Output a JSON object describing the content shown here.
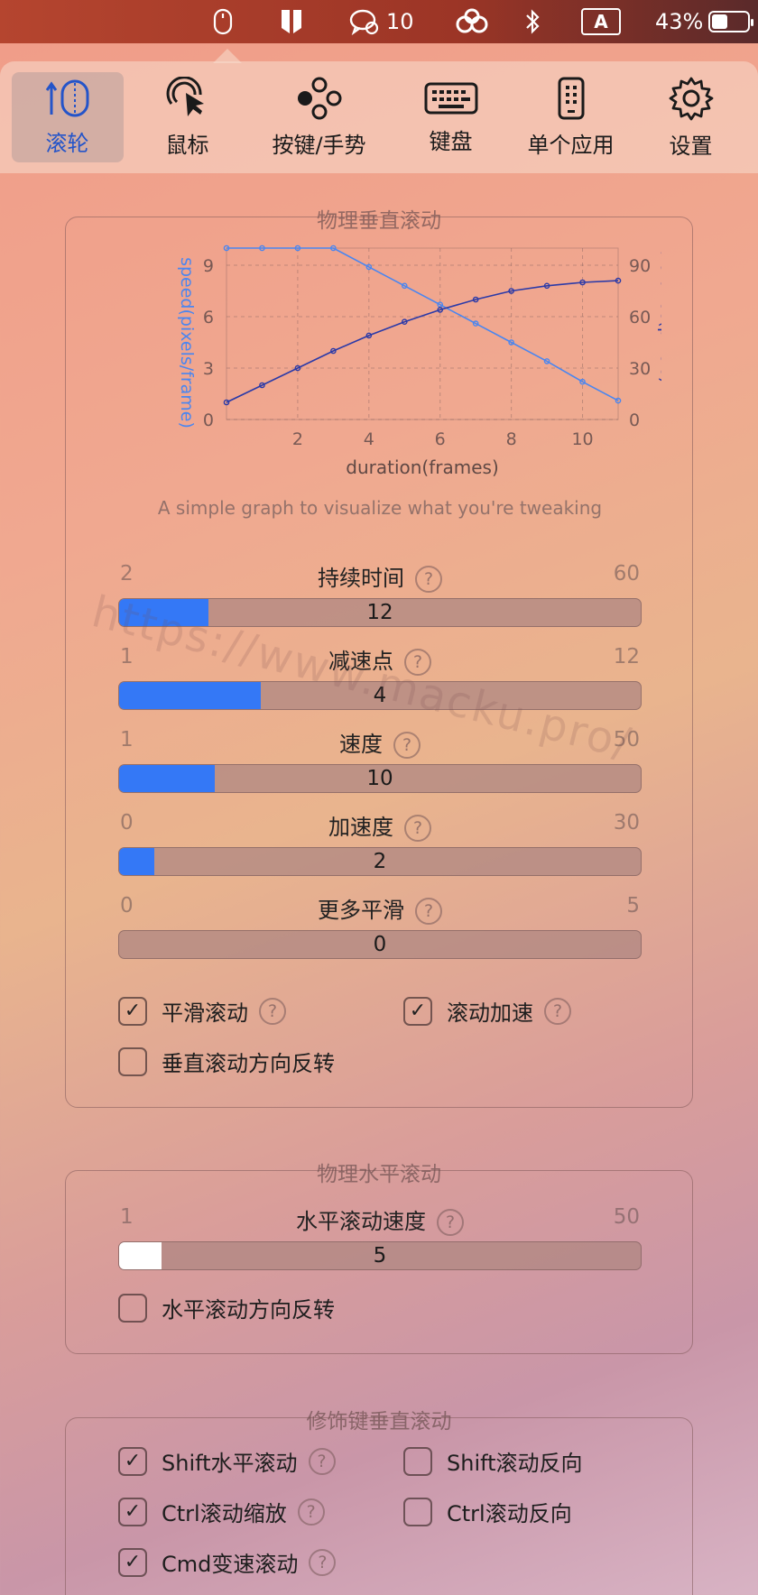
{
  "menubar": {
    "wechat_count": "10",
    "input_method": "A",
    "battery": "43%",
    "battery_level": 0.43
  },
  "toolbar": {
    "items": [
      {
        "label": "滚轮",
        "icon": "scroll-wheel-icon",
        "active": true
      },
      {
        "label": "鼠标",
        "icon": "mouse-pointer-icon",
        "active": false
      },
      {
        "label": "按键/手势",
        "icon": "gesture-buttons-icon",
        "active": false
      },
      {
        "label": "键盘",
        "icon": "keyboard-icon",
        "active": false
      },
      {
        "label": "单个应用",
        "icon": "app-device-icon",
        "active": false
      },
      {
        "label": "设置",
        "icon": "gear-icon",
        "active": false
      }
    ]
  },
  "vertical": {
    "title": "物理垂直滚动",
    "chart_caption": "A simple graph to visualize what you're tweaking",
    "sliders": [
      {
        "label": "持续时间",
        "min": "2",
        "max": "60",
        "value": "12",
        "fill": 0.172
      },
      {
        "label": "减速点",
        "min": "1",
        "max": "12",
        "value": "4",
        "fill": 0.272
      },
      {
        "label": "速度",
        "min": "1",
        "max": "50",
        "value": "10",
        "fill": 0.184
      },
      {
        "label": "加速度",
        "min": "0",
        "max": "30",
        "value": "2",
        "fill": 0.067
      },
      {
        "label": "更多平滑",
        "min": "0",
        "max": "5",
        "value": "0",
        "fill": 0
      }
    ],
    "checks": [
      {
        "label": "平滑滚动",
        "checked": true,
        "help": true
      },
      {
        "label": "滚动加速",
        "checked": true,
        "help": true
      },
      {
        "label": "垂直滚动方向反转",
        "checked": false,
        "help": false
      }
    ]
  },
  "horizontal": {
    "title": "物理水平滚动",
    "slider": {
      "label": "水平滚动速度",
      "min": "1",
      "max": "50",
      "value": "5",
      "fill": 0.082
    },
    "check": {
      "label": "水平滚动方向反转",
      "checked": false
    }
  },
  "modifier": {
    "title": "修饰键垂直滚动",
    "checks": [
      {
        "label": "Shift水平滚动",
        "checked": true,
        "help": true
      },
      {
        "label": "Shift滚动反向",
        "checked": false,
        "help": false
      },
      {
        "label": "Ctrl滚动缩放",
        "checked": true,
        "help": true
      },
      {
        "label": "Ctrl滚动反向",
        "checked": false,
        "help": false
      },
      {
        "label": "Cmd变速滚动",
        "checked": true,
        "help": true
      }
    ]
  },
  "watermark": "https://www.macku.pro/",
  "chart_data": {
    "type": "line",
    "xlabel": "duration(frames)",
    "ylabel": "speed(pixels/frame)",
    "ylabel_right": "distance(pixels)",
    "x": [
      0,
      1,
      2,
      3,
      4,
      5,
      6,
      7,
      8,
      9,
      10,
      11
    ],
    "xlim": [
      0,
      11
    ],
    "ylim": [
      0,
      10
    ],
    "ylim_right": [
      0,
      100
    ],
    "x_ticks": [
      2,
      4,
      6,
      8,
      10
    ],
    "y_ticks": [
      0,
      3,
      6,
      9
    ],
    "y_ticks_right": [
      0,
      30,
      60,
      90
    ],
    "grid": true,
    "series": [
      {
        "name": "speed(pixels/frame)",
        "axis": "left",
        "color": "#4a86f0",
        "values": [
          10,
          10,
          10,
          10,
          8.9,
          7.8,
          6.7,
          5.6,
          4.5,
          3.4,
          2.2,
          1.1
        ]
      },
      {
        "name": "distance(pixels)",
        "axis": "right",
        "color": "#2b3aa8",
        "values": [
          10,
          20,
          30,
          40,
          49,
          57,
          64,
          70,
          75,
          78,
          80,
          81
        ]
      }
    ]
  }
}
